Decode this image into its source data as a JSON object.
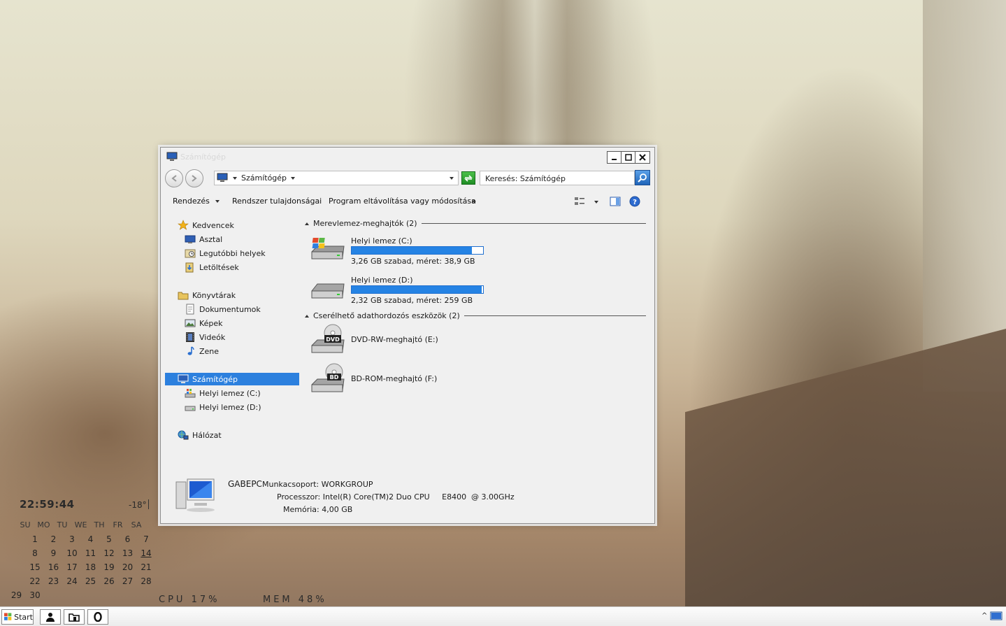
{
  "window": {
    "title": "Számítógép",
    "address": {
      "crumb": "Számítógép"
    },
    "search": {
      "placeholder": "Keresés: Számítógép"
    }
  },
  "commands": {
    "organize": "Rendezés",
    "system_properties": "Rendszer tulajdonságai",
    "uninstall_program": "Program eltávolítása vagy módosítása",
    "more": "»"
  },
  "nav": {
    "favorites": "Kedvencek",
    "desktop": "Asztal",
    "recent_places": "Legutóbbi helyek",
    "downloads": "Letöltések",
    "libraries": "Könyvtárak",
    "documents": "Dokumentumok",
    "pictures": "Képek",
    "videos": "Videók",
    "music": "Zene",
    "computer": "Számítógép",
    "local_c": "Helyi lemez (C:)",
    "local_d": "Helyi lemez (D:)",
    "network": "Hálózat"
  },
  "groups": {
    "hard_disks": "Merevlemez-meghajtók (2)",
    "removable": "Cserélhető adathordozós eszközök (2)"
  },
  "drives": [
    {
      "name": "Helyi lemez (C:)",
      "size_text": "3,26 GB szabad, méret: 38,9 GB",
      "used_fraction": 0.916
    },
    {
      "name": "Helyi lemez (D:)",
      "size_text": "2,32 GB szabad, méret: 259 GB",
      "used_fraction": 0.991
    }
  ],
  "removable_drives": [
    {
      "name": "DVD-RW-meghajtó (E:)",
      "badge": "DVD"
    },
    {
      "name": "BD-ROM-meghajtó (F:)",
      "badge": "BD"
    }
  ],
  "details": {
    "pc_name": "GABEPC",
    "workgroup_label": "Munkacsoport:",
    "workgroup": "WORKGROUP",
    "processor_label": "Processzor:",
    "processor": "Intel(R) Core(TM)2 Duo CPU     E8400  @ 3.00GHz",
    "memory_label": "Memória:",
    "memory": "4,00 GB"
  },
  "widgets": {
    "clock": "22:59:44",
    "temperature": "-18°",
    "calendar": {
      "weekdays": [
        "SU",
        "MO",
        "TU",
        "WE",
        "TH",
        "FR",
        "SA"
      ],
      "weeks": [
        [
          "",
          "1",
          "2",
          "3",
          "4",
          "5",
          "6",
          "7"
        ],
        [
          "",
          "8",
          "9",
          "10",
          "11",
          "12",
          "13",
          "14"
        ],
        [
          "",
          "15",
          "16",
          "17",
          "18",
          "19",
          "20",
          "21"
        ],
        [
          "",
          "22",
          "23",
          "24",
          "25",
          "26",
          "27",
          "28"
        ],
        [
          "",
          "29",
          "30",
          "",
          "",
          "",
          "",
          ""
        ]
      ],
      "today": "14"
    },
    "cpu": "CPU  17%",
    "mem": "MEM  48%"
  },
  "taskbar": {
    "start_label": "Start",
    "tray_arrow": "^"
  },
  "colors": {
    "selection": "#2c80de",
    "drive_bar": "#2583e4"
  }
}
